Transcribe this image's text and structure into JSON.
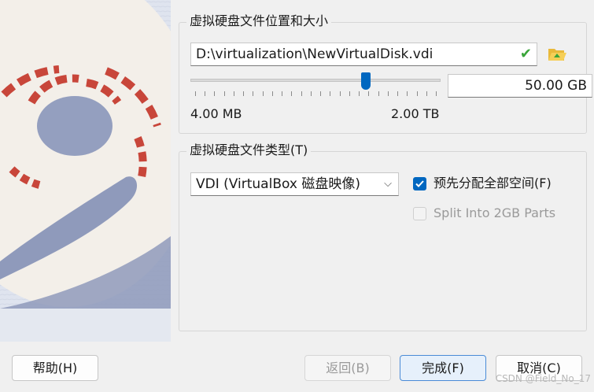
{
  "location_group": {
    "title": "虚拟硬盘文件位置和大小",
    "path_value": "D:\\virtualization\\NewVirtualDisk.vdi",
    "size_value": "50.00 GB",
    "slider_min_label": "4.00 MB",
    "slider_max_label": "2.00 TB",
    "slider_position": 0.71
  },
  "type_group": {
    "title": "虚拟硬盘文件类型(T)",
    "format_selected": "VDI (VirtualBox 磁盘映像)",
    "preallocate_label": "预先分配全部空间(F)",
    "preallocate_checked": true,
    "split_label": "Split Into 2GB Parts",
    "split_enabled": false
  },
  "buttons": {
    "help": "帮助(H)",
    "back": "返回(B)",
    "finish": "完成(F)",
    "cancel": "取消(C)"
  },
  "watermark": "CSDN @Field_No_17",
  "colors": {
    "accent": "#0067c0",
    "check_valid": "#3aa53a",
    "art_red": "#c8463a",
    "art_blue": "#8e99bb"
  },
  "icons": {
    "valid": "check-icon",
    "folder": "folder-open-icon",
    "dropdown": "chevron-down-icon"
  }
}
